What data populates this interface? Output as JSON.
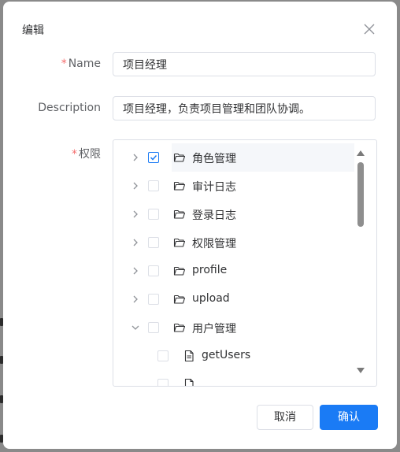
{
  "dialog": {
    "title": "编辑",
    "close_icon": "close-icon"
  },
  "form": {
    "name": {
      "required_mark": "*",
      "label": "Name",
      "value": "项目经理"
    },
    "description": {
      "label": "Description",
      "value": "项目经理，负责项目管理和团队协调。"
    },
    "permissions": {
      "required_mark": "*",
      "label": "权限",
      "tree": [
        {
          "label": "角色管理",
          "expanded": false,
          "checked": true,
          "icon": "folder-open-icon"
        },
        {
          "label": "审计日志",
          "expanded": false,
          "checked": false,
          "icon": "folder-open-icon"
        },
        {
          "label": "登录日志",
          "expanded": false,
          "checked": false,
          "icon": "folder-open-icon"
        },
        {
          "label": "权限管理",
          "expanded": false,
          "checked": false,
          "icon": "folder-open-icon"
        },
        {
          "label": "profile",
          "expanded": false,
          "checked": false,
          "icon": "folder-open-icon"
        },
        {
          "label": "upload",
          "expanded": false,
          "checked": false,
          "icon": "folder-open-icon"
        },
        {
          "label": "用户管理",
          "expanded": true,
          "checked": false,
          "icon": "folder-open-icon"
        },
        {
          "label": "getUsers",
          "expanded": false,
          "checked": false,
          "icon": "document-icon"
        }
      ]
    }
  },
  "footer": {
    "cancel_label": "取消",
    "confirm_label": "确认"
  },
  "colors": {
    "primary": "#1a7bf5",
    "required": "#f56c6c",
    "border": "#dcdfe6"
  }
}
